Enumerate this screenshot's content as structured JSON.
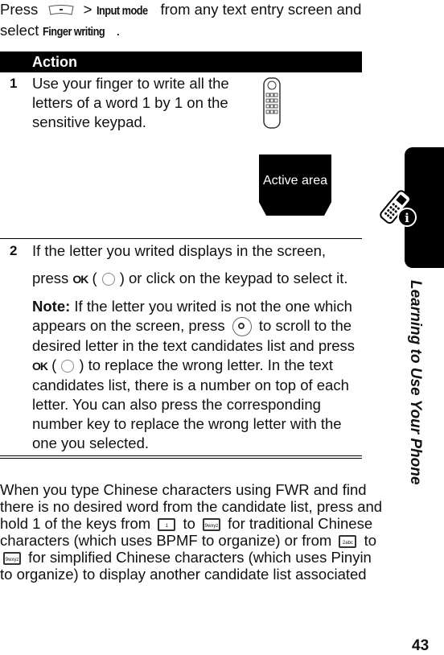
{
  "intro": {
    "press": "Press",
    "menu_icon": "menu-key-icon",
    "gt": ">",
    "input_mode": "Input mode",
    "rest1": "from any text entry screen and select",
    "finger_writing": "Finger writing",
    "period": "."
  },
  "table": {
    "header": "Action",
    "rows": [
      {
        "num": "1",
        "text": "Use your finger to write all the letters of a word 1 by 1 on the sensitive keypad.",
        "image_label": "Active area"
      },
      {
        "num": "2",
        "line1": "If the letter you writed displays in the screen,",
        "line2_pre": "press",
        "ok": "OK",
        "line2_post": ") or click on the keypad to select it.",
        "note_label": "Note:",
        "note_a": "If the letter you writed is not the one which appears on the screen, press",
        "note_b": "to scroll to the desired letter in the text candidates list and press",
        "note_c": ") to replace the wrong letter. In the text candidates list, there is a number on top of each letter. You can also press the corresponding number key to replace the wrong letter with the one you selected."
      }
    ]
  },
  "body": {
    "p1": "When you type Chinese characters using FWR and find there is no desired word from the candidate list, press and hold 1 of the keys from",
    "to": "to",
    "p2": "for traditional Chinese characters (which uses BPMF to organize) or from",
    "p3": "for simplified Chinese characters (which uses Pinyin to organize) to display another candidate list associated",
    "keys": [
      "1",
      "9wxyz",
      "2abc",
      "9wxyz"
    ]
  },
  "sidebar": {
    "title": "Learning to Use Your Phone"
  },
  "page_number": "43"
}
